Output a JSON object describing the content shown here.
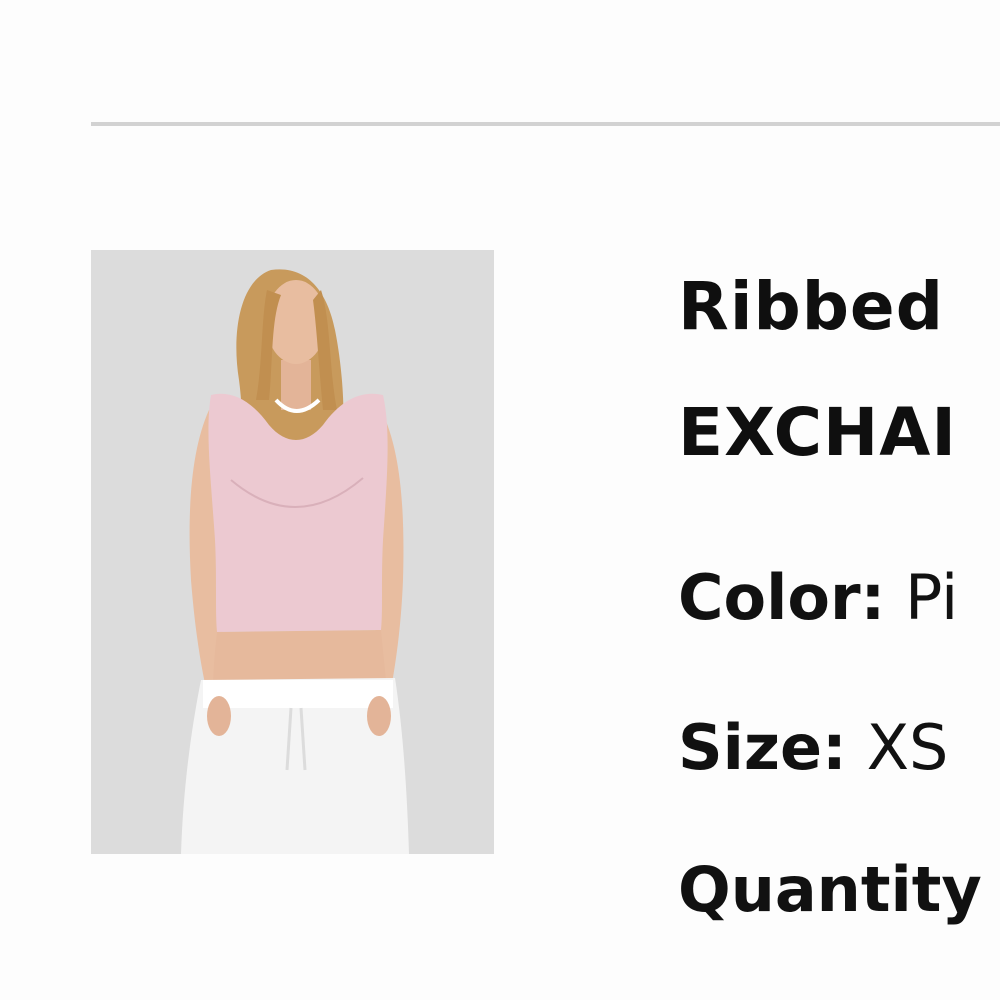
{
  "product": {
    "title_line1": "Ribbed",
    "title_line2": "EXCHAI",
    "image_alt": "Model wearing pink ribbed crop top and white sweatpants",
    "colors": {
      "background": "#dcdcdc",
      "top": "#ecc9d1",
      "pants": "#f4f4f4",
      "hair": "#c89a5c",
      "skin": "#e8bda0"
    }
  },
  "attributes": {
    "color": {
      "label": "Color:",
      "value": "Pi"
    },
    "size": {
      "label": "Size:",
      "value": "XS"
    },
    "quantity": {
      "label": "Quantity",
      "value": ""
    }
  }
}
